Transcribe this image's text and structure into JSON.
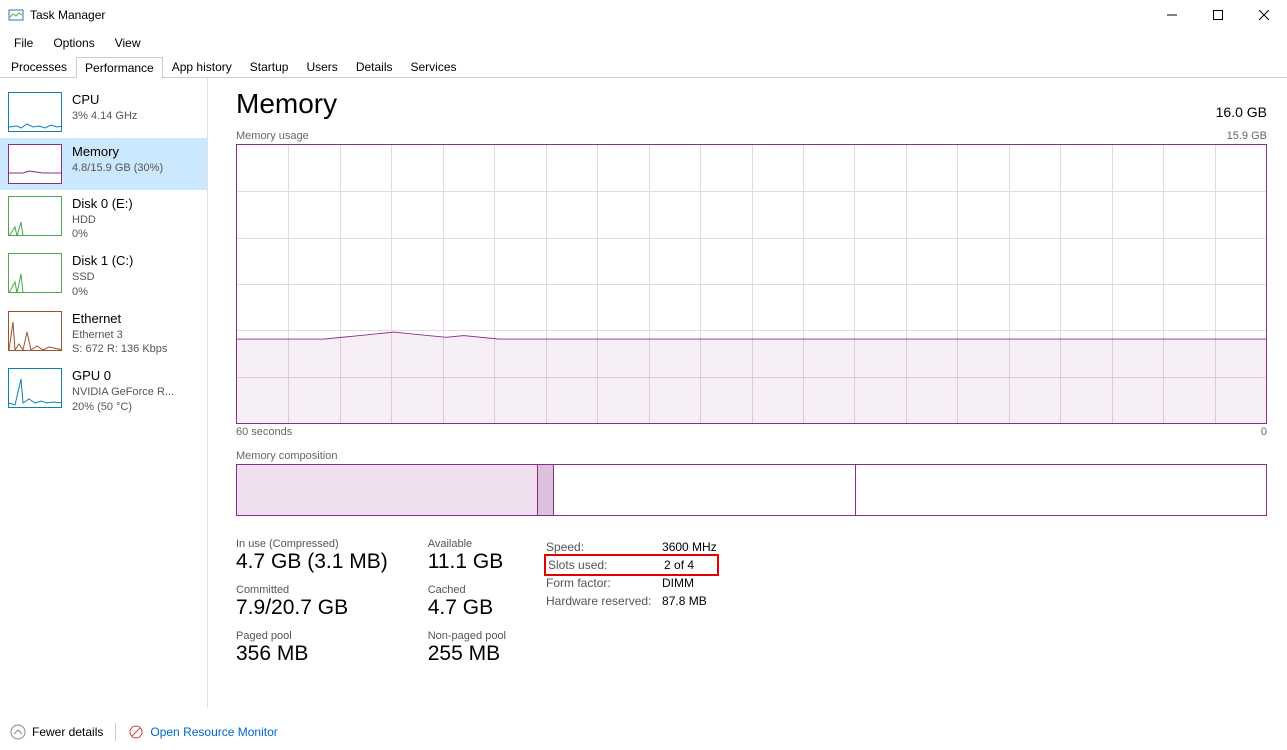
{
  "window": {
    "title": "Task Manager"
  },
  "menu": {
    "file": "File",
    "options": "Options",
    "view": "View"
  },
  "tabs": [
    "Processes",
    "Performance",
    "App history",
    "Startup",
    "Users",
    "Details",
    "Services"
  ],
  "sidebar": [
    {
      "title": "CPU",
      "sub": "3% 4.14 GHz"
    },
    {
      "title": "Memory",
      "sub": "4.8/15.9 GB (30%)"
    },
    {
      "title": "Disk 0 (E:)",
      "sub": "HDD",
      "sub2": "0%"
    },
    {
      "title": "Disk 1 (C:)",
      "sub": "SSD",
      "sub2": "0%"
    },
    {
      "title": "Ethernet",
      "sub": "Ethernet 3",
      "sub2": "S: 672 R: 136 Kbps"
    },
    {
      "title": "GPU 0",
      "sub": "NVIDIA GeForce R...",
      "sub2": "20%  (50 °C)"
    }
  ],
  "page": {
    "title": "Memory",
    "total": "16.0 GB",
    "usage_label": "Memory usage",
    "usage_max": "15.9 GB",
    "time_left": "60 seconds",
    "time_right": "0",
    "comp_label": "Memory composition"
  },
  "stats": {
    "inuse_label": "In use (Compressed)",
    "inuse_value": "4.7 GB (3.1 MB)",
    "available_label": "Available",
    "available_value": "11.1 GB",
    "committed_label": "Committed",
    "committed_value": "7.9/20.7 GB",
    "cached_label": "Cached",
    "cached_value": "4.7 GB",
    "paged_label": "Paged pool",
    "paged_value": "356 MB",
    "nonpaged_label": "Non-paged pool",
    "nonpaged_value": "255 MB"
  },
  "specs": {
    "speed_label": "Speed:",
    "speed_value": "3600 MHz",
    "slots_label": "Slots used:",
    "slots_value": "2 of 4",
    "form_label": "Form factor:",
    "form_value": "DIMM",
    "reserved_label": "Hardware reserved:",
    "reserved_value": "87.8 MB"
  },
  "footer": {
    "fewer": "Fewer details",
    "monitor": "Open Resource Monitor"
  },
  "chart_data": {
    "type": "area",
    "title": "Memory usage",
    "ylim": [
      0,
      15.9
    ],
    "ylabel": "GB",
    "xlabel": "seconds",
    "x_range": [
      60,
      0
    ],
    "series": [
      {
        "name": "Memory usage (GB)",
        "values": [
          4.8,
          4.8,
          4.8,
          4.8,
          4.8,
          4.8,
          4.9,
          5.0,
          5.1,
          5.2,
          5.1,
          5.0,
          4.9,
          5.0,
          4.9,
          4.8,
          4.8,
          4.8,
          4.8,
          4.8,
          4.8,
          4.8,
          4.8,
          4.8,
          4.8,
          4.8,
          4.8,
          4.8,
          4.8,
          4.8,
          4.8,
          4.8,
          4.8,
          4.8,
          4.8,
          4.8,
          4.8,
          4.8,
          4.8,
          4.8,
          4.8,
          4.8,
          4.8,
          4.8,
          4.8,
          4.8,
          4.8,
          4.8,
          4.8,
          4.8,
          4.8,
          4.8,
          4.8,
          4.8,
          4.8,
          4.8,
          4.8,
          4.8,
          4.8,
          4.8
        ]
      }
    ],
    "composition": {
      "in_use_gb": 4.7,
      "modified_gb": 0.1,
      "standby_gb": 4.7,
      "free_gb": 6.4,
      "total_gb": 15.9
    }
  }
}
